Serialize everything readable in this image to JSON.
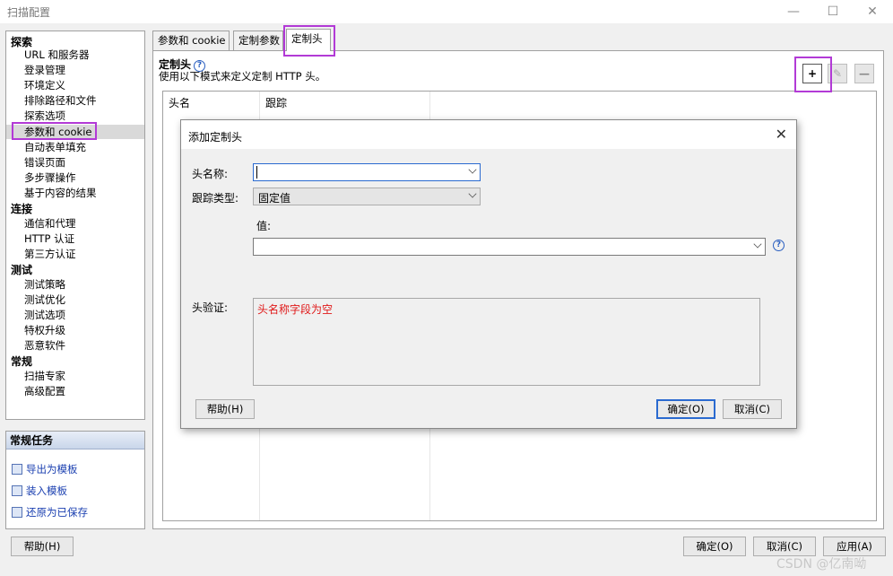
{
  "window": {
    "title": "扫描配置",
    "minimize": "—",
    "maximize": "☐",
    "close": "✕"
  },
  "sidebar": {
    "categories": [
      "探索",
      "连接",
      "测试",
      "常规"
    ],
    "explore_items": [
      "URL 和服务器",
      "登录管理",
      "环境定义",
      "排除路径和文件",
      "探索选项",
      "参数和 cookie",
      "自动表单填充",
      "错误页面",
      "多步骤操作",
      "基于内容的结果"
    ],
    "connect_items": [
      "通信和代理",
      "HTTP 认证",
      "第三方认证"
    ],
    "test_items": [
      "测试策略",
      "测试优化",
      "测试选项",
      "特权升级",
      "恶意软件"
    ],
    "general_items": [
      "扫描专家",
      "高级配置"
    ]
  },
  "tasks": {
    "header": "常规任务",
    "items": [
      "导出为模板",
      "装入模板",
      "还原为已保存"
    ]
  },
  "tabs": [
    "参数和 cookie",
    "定制参数",
    "定制头"
  ],
  "panel": {
    "title": "定制头",
    "description": "使用以下模式来定义定制 HTTP 头。",
    "add_button": "+",
    "edit_button": "✎",
    "remove_button": "—",
    "columns": [
      "头名",
      "跟踪"
    ]
  },
  "dialog": {
    "title": "添加定制头",
    "close": "✕",
    "name_label": "头名称:",
    "name_value": "",
    "track_label": "跟踪类型:",
    "track_value": "固定值",
    "value_label": "值:",
    "value_value": "",
    "validation_label": "头验证:",
    "validation_message": "头名称字段为空",
    "help_button": "帮助(H)",
    "ok_button": "确定(O)",
    "cancel_button": "取消(C)"
  },
  "bottom": {
    "help_button": "帮助(H)",
    "ok_button": "确定(O)",
    "cancel_button": "取消(C)",
    "apply_button": "应用(A)"
  },
  "watermark": "CSDN @亿南呦",
  "colors": {
    "highlight": "#b23ad6",
    "validation_error": "#e01818",
    "link": "#1a3fb0"
  }
}
